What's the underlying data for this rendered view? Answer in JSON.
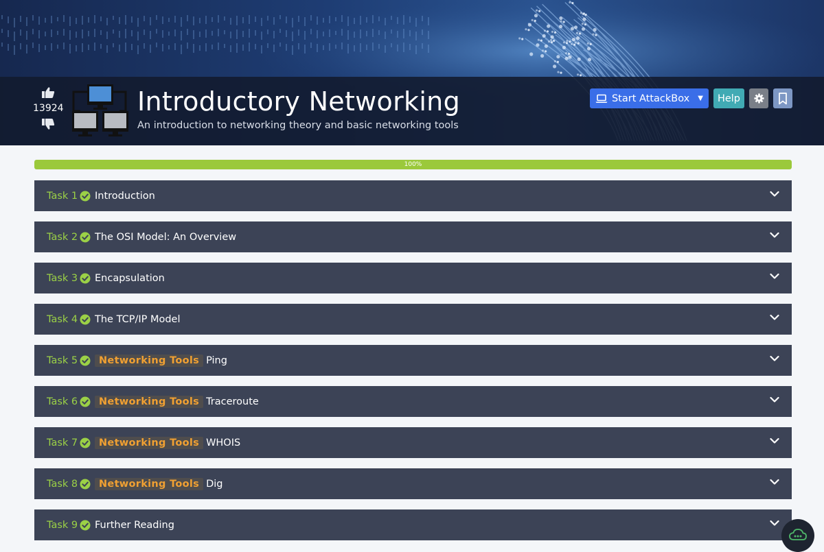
{
  "room": {
    "title": "Introductory Networking",
    "subtitle": "An introduction to networking theory and basic networking tools",
    "votes": "13924"
  },
  "actions": {
    "start_attackbox": "Start AttackBox",
    "help": "Help"
  },
  "progress": {
    "percent": 100,
    "label": "100%"
  },
  "tasks": [
    {
      "num": "Task 1",
      "tag": "",
      "title": "Introduction",
      "completed": true
    },
    {
      "num": "Task 2",
      "tag": "",
      "title": "The OSI Model: An Overview",
      "completed": true
    },
    {
      "num": "Task 3",
      "tag": "",
      "title": "Encapsulation",
      "completed": true
    },
    {
      "num": "Task 4",
      "tag": "",
      "title": "The TCP/IP Model",
      "completed": true
    },
    {
      "num": "Task 5",
      "tag": "Networking Tools",
      "title": "Ping",
      "completed": true
    },
    {
      "num": "Task 6",
      "tag": "Networking Tools",
      "title": "Traceroute",
      "completed": true
    },
    {
      "num": "Task 7",
      "tag": "Networking Tools",
      "title": "WHOIS",
      "completed": true
    },
    {
      "num": "Task 8",
      "tag": "Networking Tools",
      "title": "Dig",
      "completed": true
    },
    {
      "num": "Task 9",
      "tag": "",
      "title": "Further Reading",
      "completed": true
    }
  ],
  "colors": {
    "task_bg": "#3c4356",
    "task_num": "#9bd146",
    "tag_text": "#f0a032",
    "progress": "#9bc93b",
    "attack_button": "#3a6ee8",
    "help_button": "#41aab4"
  },
  "icons": {
    "upvote": "thumbs-up-icon",
    "downvote": "thumbs-down-icon",
    "room": "network-computers-icon",
    "attackbox": "laptop-icon",
    "settings": "gear-icon",
    "bookmark": "bookmark-icon",
    "task_complete": "check-circle-icon",
    "expand": "chevron-down-icon",
    "chat": "cloud-chat-icon"
  }
}
